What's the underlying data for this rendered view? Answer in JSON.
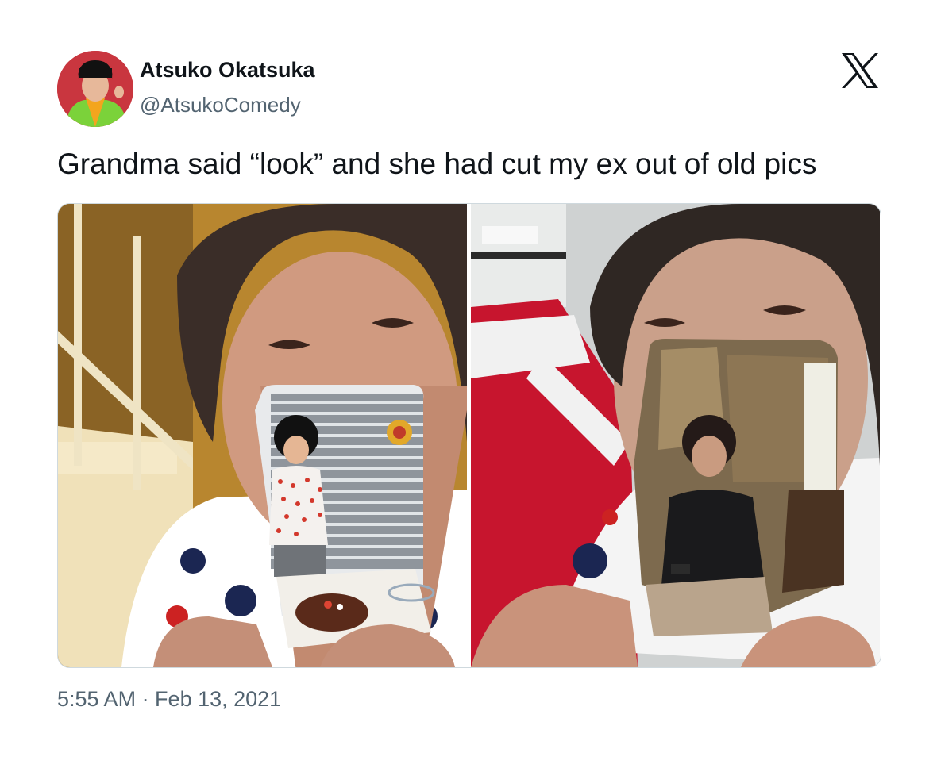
{
  "author": {
    "name": "Atsuko Okatsuka",
    "handle": "@AtsukoComedy"
  },
  "platform_logo": "x-logo-icon",
  "tweet": {
    "text": "Grandma said “look” and she had cut my ex out of old pics",
    "timestamp": "5:55 AM · Feb 13, 2021"
  },
  "media": [
    {
      "icon": "photo-grandma-holding-polka-dot-photo"
    },
    {
      "icon": "photo-grandma-holding-black-dress-photo"
    }
  ],
  "colors": {
    "text_primary": "#0f1419",
    "text_secondary": "#536471",
    "border": "#cfd9de",
    "background": "#ffffff"
  }
}
